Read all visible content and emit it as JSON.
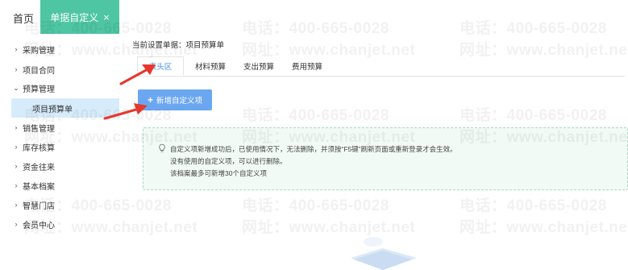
{
  "top_tabs": {
    "home_label": "首页",
    "active_label": "单据自定义",
    "close_glyph": "×"
  },
  "sidebar": {
    "items": [
      {
        "label": "采购管理",
        "expanded": false
      },
      {
        "label": "项目合同",
        "expanded": false
      },
      {
        "label": "预算管理",
        "expanded": true
      },
      {
        "label": "销售管理",
        "expanded": false
      },
      {
        "label": "库存核算",
        "expanded": false
      },
      {
        "label": "资金往来",
        "expanded": false
      },
      {
        "label": "基本档案",
        "expanded": false
      },
      {
        "label": "智慧门店",
        "expanded": false
      },
      {
        "label": "会员中心",
        "expanded": false
      }
    ],
    "sub_item": "项目预算单",
    "chevron_right": "›",
    "chevron_down": "⌄"
  },
  "main": {
    "current_doc": "当前设置单据：项目预算单",
    "tabs": [
      "表头区",
      "材料预算",
      "支出预算",
      "费用预算"
    ],
    "active_tab": 0,
    "add_button": "新增自定义项",
    "add_plus": "+",
    "notice_lines": [
      "自定义项新增成功后，已使用情况下，无法删除，并须按“F5键”刷新页面或重新登录才会生效。",
      "没有使用的自定义项，可以进行删除。",
      "该档案最多可新增30个自定义项"
    ]
  },
  "watermark": {
    "phone": "电话：400-665-0028",
    "site": "网址：www.chanjet.net"
  },
  "colors": {
    "tab_active_bg": "#4ec5a3",
    "sidebar_selected_bg": "#d7ecfb",
    "button_bg": "#6aa7f0",
    "notice_bg": "#f2faf6",
    "arrow": "#e8372c",
    "active_subtab_text": "#3f8ef0"
  }
}
